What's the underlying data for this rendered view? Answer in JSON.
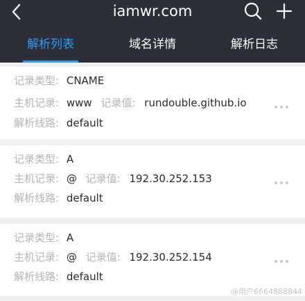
{
  "header": {
    "title": "iamwr.com",
    "icons": {
      "back": "chevron-left-icon",
      "search": "search-icon",
      "add": "plus-icon"
    }
  },
  "tabs": [
    {
      "label": "解析列表",
      "active": true
    },
    {
      "label": "域名详情",
      "active": false
    },
    {
      "label": "解析日志",
      "active": false
    }
  ],
  "labels": {
    "record_type": "记录类型:",
    "host_record": "主机记录:",
    "record_value": "记录值:",
    "resolve_line": "解析线路:"
  },
  "records": [
    {
      "type": "CNAME",
      "host": "www",
      "value": "rundouble.github.io",
      "line": "default"
    },
    {
      "type": "A",
      "host": "@",
      "value": "192.30.252.153",
      "line": "default"
    },
    {
      "type": "A",
      "host": "@",
      "value": "192.30.252.154",
      "line": "default"
    }
  ],
  "watermark": "@用户6664888844",
  "colors": {
    "header_bg": "#2c2f37",
    "accent": "#2e9bf2",
    "label": "#b5b5b8",
    "value": "#2a2a2a",
    "page_bg": "#f0f0f2"
  }
}
